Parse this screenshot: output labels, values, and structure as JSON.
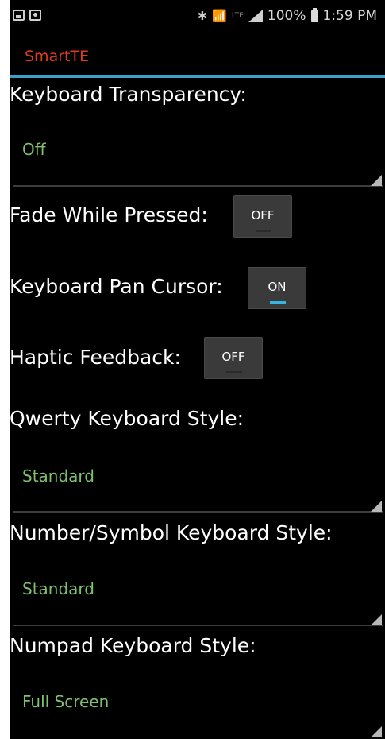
{
  "status_bar": {
    "icons_left": [
      "image-icon",
      "photo-icon"
    ],
    "icons_right": [
      "bluetooth-icon",
      "wifi-icon",
      "lte-icon",
      "signal-icon"
    ],
    "battery": "100%",
    "time": "1:59 PM"
  },
  "app": {
    "title": "SmartTE",
    "title_color": "#e03a22",
    "accent_color": "#33b5e5"
  },
  "settings": {
    "keyboard_transparency": {
      "label": "Keyboard Transparency:",
      "value": "Off"
    },
    "fade_while_pressed": {
      "label": "Fade While Pressed:",
      "state": "OFF"
    },
    "keyboard_pan_cursor": {
      "label": "Keyboard Pan Cursor:",
      "state": "ON"
    },
    "haptic_feedback": {
      "label": "Haptic Feedback:",
      "state": "OFF"
    },
    "qwerty_keyboard_style": {
      "label": "Qwerty Keyboard Style:",
      "value": "Standard"
    },
    "number_symbol_keyboard_style": {
      "label": "Number/Symbol Keyboard Style:",
      "value": "Standard"
    },
    "numpad_keyboard_style": {
      "label": "Numpad Keyboard Style:",
      "value": "Full Screen"
    }
  }
}
